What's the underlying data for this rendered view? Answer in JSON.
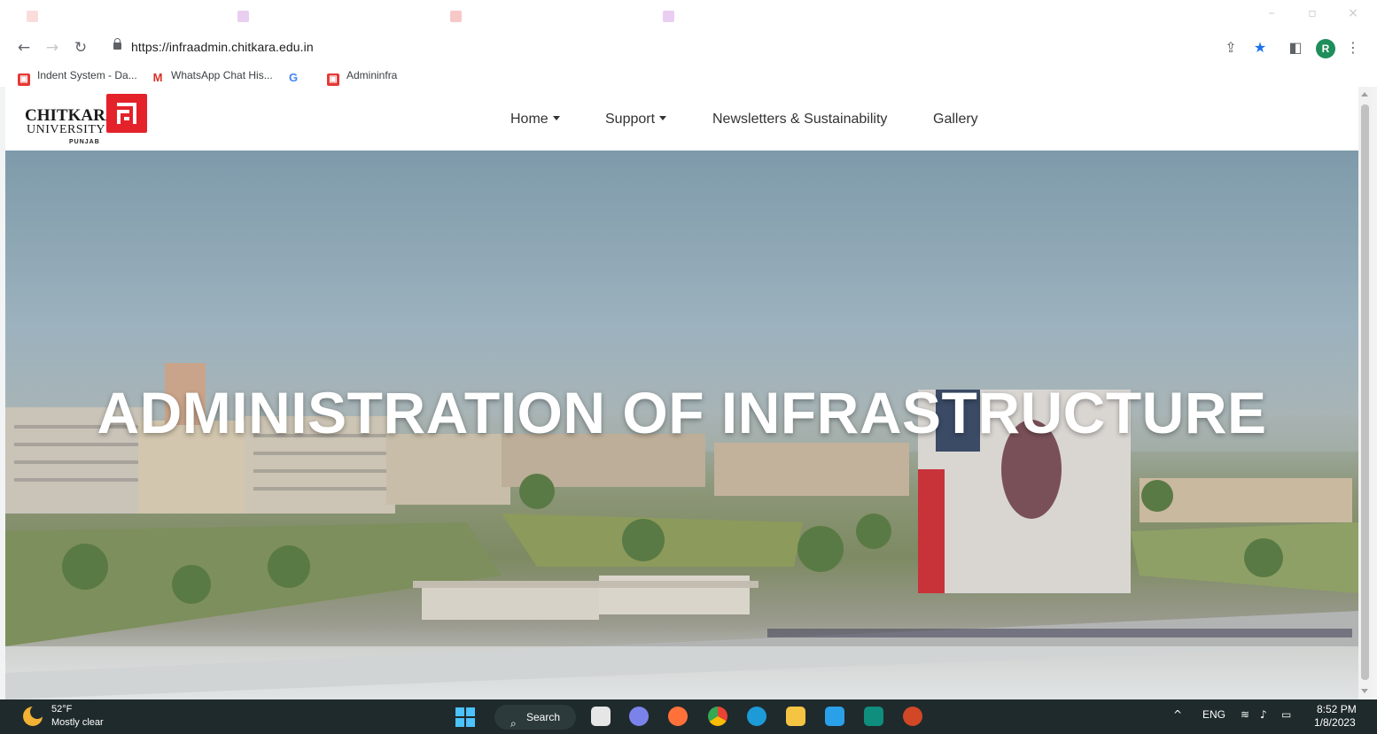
{
  "browser": {
    "url": "https://infraadmin.chitkara.edu.in",
    "profile_initial": "R",
    "bookmarks": [
      {
        "label": "Indent System - Da...",
        "icon": "indent-system-favicon",
        "color": "#e53935"
      },
      {
        "label": "WhatsApp Chat His...",
        "icon": "gmail-icon",
        "color": "#d93025"
      },
      {
        "label": "",
        "icon": "google-icon",
        "color": "#4285f4"
      },
      {
        "label": "Admininfra",
        "icon": "admininfra-favicon",
        "color": "#e53935"
      }
    ],
    "nav_icons": {
      "back": "back-arrow-icon",
      "forward": "forward-arrow-icon",
      "reload": "reload-icon"
    },
    "toolbar_icons": [
      "share-icon",
      "star-bookmark-icon",
      "side-panel-icon",
      "profile-avatar",
      "more-menu-icon"
    ]
  },
  "site": {
    "logo": {
      "name": "CHITKARA",
      "sub": "UNIVERSITY",
      "region": "PUNJAB",
      "brand_color": "#e3222a"
    },
    "menu": [
      {
        "label": "Home",
        "dropdown": true
      },
      {
        "label": "Support",
        "dropdown": true
      },
      {
        "label": "Newsletters & Sustainability",
        "dropdown": false
      },
      {
        "label": "Gallery",
        "dropdown": false
      }
    ],
    "hero_title": "ADMINISTRATION OF INFRASTRUCTURE"
  },
  "taskbar": {
    "weather_temp": "52°F",
    "weather_desc": "Mostly clear",
    "search_label": "Search",
    "tray_lang": "ENG",
    "time": "8:52 PM",
    "date": "1/8/2023"
  }
}
